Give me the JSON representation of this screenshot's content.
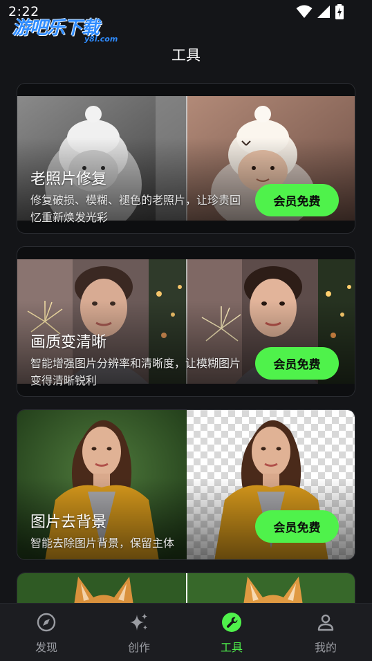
{
  "status_bar": {
    "time": "2:22"
  },
  "watermark": {
    "text": "游吧乐下载",
    "sub": "y8l.com"
  },
  "page": {
    "title": "工具"
  },
  "cards": [
    {
      "title": "老照片修复",
      "description": "修复破损、模糊、褪色的老照片，让珍贵回忆重新焕发光彩",
      "button": "会员免费"
    },
    {
      "title": "画质变清晰",
      "description": "智能增强图片分辨率和清晰度，让模糊图片变得清晰锐利",
      "button": "会员免费"
    },
    {
      "title": "图片去背景",
      "description": "智能去除图片背景，保留主体",
      "button": "会员免费"
    }
  ],
  "bottom_nav": [
    {
      "label": "发现",
      "icon": "compass-icon"
    },
    {
      "label": "创作",
      "icon": "sparkle-icon"
    },
    {
      "label": "工具",
      "icon": "wrench-icon"
    },
    {
      "label": "我的",
      "icon": "user-icon"
    }
  ],
  "colors": {
    "accent": "#4ff24b",
    "background": "#141518",
    "nav_background": "#1c1d21"
  }
}
